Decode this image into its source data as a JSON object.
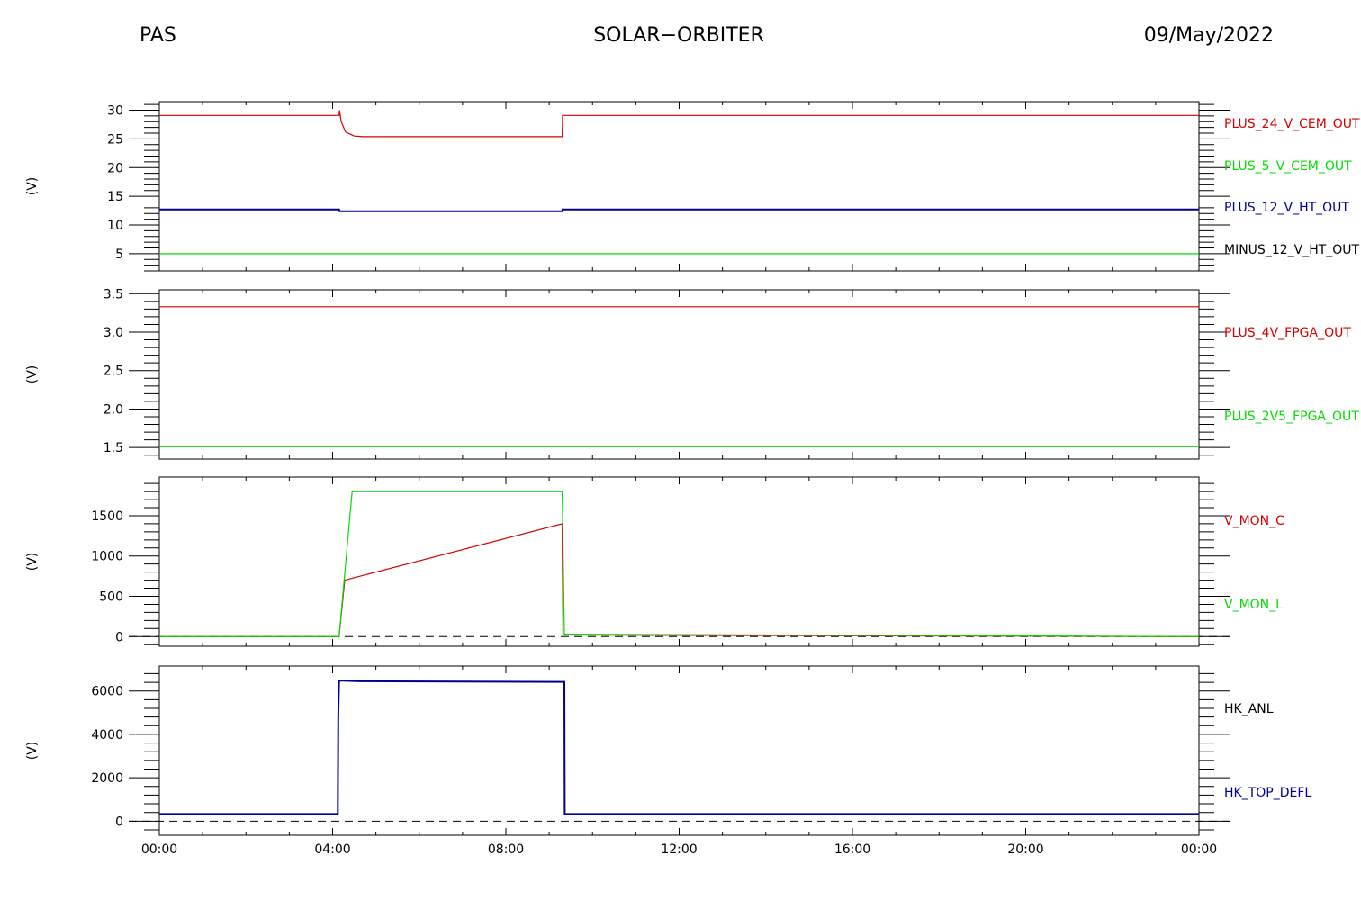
{
  "header": {
    "left": "PAS",
    "center": "SOLAR−ORBITER",
    "right": "09/May/2022"
  },
  "colors": {
    "red": "#d40000",
    "green": "#00dd00",
    "blue": "#00008c",
    "black": "#000000"
  },
  "chart_data": [
    {
      "type": "line",
      "ylabel": "(V)",
      "ylim": [
        2,
        31.5
      ],
      "yticks": [
        5,
        10,
        15,
        20,
        25,
        30
      ],
      "xlim": [
        0,
        24
      ],
      "xticks": [
        "00:00",
        "04:00",
        "08:00",
        "12:00",
        "16:00",
        "20:00",
        "00:00"
      ],
      "series": [
        {
          "name": "PLUS_24_V_CEM_OUT",
          "color": "red",
          "x": [
            0,
            4.15,
            4.16,
            4.2,
            4.3,
            4.5,
            4.7,
            9.3,
            9.31,
            24
          ],
          "y": [
            29.1,
            29.1,
            30.0,
            28.0,
            26.2,
            25.5,
            25.4,
            25.4,
            29.1,
            29.1
          ]
        },
        {
          "name": "PLUS_5_V_CEM_OUT",
          "color": "green",
          "x": [],
          "y": []
        },
        {
          "name": "PLUS_12_V_HT_OUT",
          "color": "blue",
          "x": [
            0,
            4.15,
            4.16,
            9.3,
            9.31,
            24
          ],
          "y": [
            12.7,
            12.7,
            12.4,
            12.4,
            12.7,
            12.7
          ]
        },
        {
          "name": "MINUS_12_V_HT_OUT",
          "color": "black",
          "x": [],
          "y": []
        },
        {
          "name": "",
          "color": "green",
          "x": [
            0,
            24
          ],
          "y": [
            5.0,
            5.0
          ]
        }
      ]
    },
    {
      "type": "line",
      "ylabel": "(V)",
      "ylim": [
        1.35,
        3.55
      ],
      "yticks": [
        1.5,
        2.0,
        2.5,
        3.0,
        3.5
      ],
      "xlim": [
        0,
        24
      ],
      "xticks": [
        "00:00",
        "04:00",
        "08:00",
        "12:00",
        "16:00",
        "20:00",
        "00:00"
      ],
      "series": [
        {
          "name": "PLUS_4V_FPGA_OUT",
          "color": "red",
          "x": [
            0,
            24
          ],
          "y": [
            3.33,
            3.33
          ]
        },
        {
          "name": "PLUS_2V5_FPGA_OUT",
          "color": "green",
          "x": [
            0,
            24
          ],
          "y": [
            1.51,
            1.51
          ]
        }
      ]
    },
    {
      "type": "line",
      "ylabel": "(V)",
      "ylim": [
        -120,
        1980
      ],
      "yticks": [
        0,
        500,
        1000,
        1500
      ],
      "xlim": [
        0,
        24
      ],
      "xticks": [
        "00:00",
        "04:00",
        "08:00",
        "12:00",
        "16:00",
        "20:00",
        "00:00"
      ],
      "baseline": 0,
      "series": [
        {
          "name": "V_MON_C",
          "color": "red",
          "x": [
            0,
            4.15,
            4.28,
            9.3,
            9.3,
            9.32,
            24
          ],
          "y": [
            0,
            0,
            700,
            1400,
            1250,
            20,
            0
          ]
        },
        {
          "name": "V_MON_L",
          "color": "green",
          "x": [
            0,
            4.15,
            4.45,
            9.25,
            9.3,
            9.35,
            24
          ],
          "y": [
            0,
            0,
            1800,
            1800,
            1800,
            30,
            0
          ]
        }
      ]
    },
    {
      "type": "line",
      "ylabel": "(V)",
      "ylim": [
        -650,
        7150
      ],
      "yticks": [
        0,
        2000,
        4000,
        6000
      ],
      "xlim": [
        0,
        24
      ],
      "xticks": [
        "00:00",
        "04:00",
        "08:00",
        "12:00",
        "16:00",
        "20:00",
        "00:00"
      ],
      "baseline": 0,
      "series": [
        {
          "name": "HK_ANL",
          "color": "black",
          "x": [],
          "y": []
        },
        {
          "name": "HK_TOP_DEFL",
          "color": "blue",
          "x": [
            0,
            4.12,
            4.13,
            4.15,
            4.6,
            9.3,
            9.35,
            9.36,
            24
          ],
          "y": [
            330,
            330,
            4800,
            6480,
            6450,
            6420,
            6420,
            330,
            330
          ]
        }
      ]
    }
  ]
}
